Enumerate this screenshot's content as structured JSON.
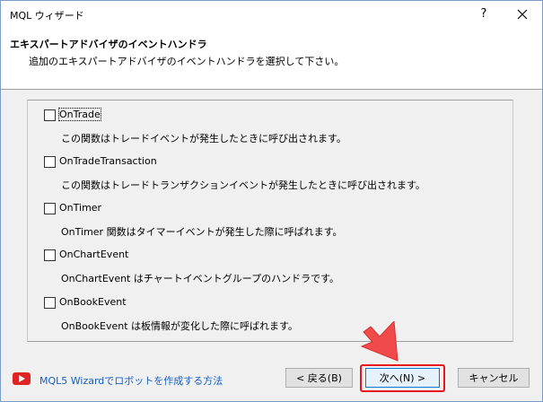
{
  "window": {
    "title": "MQL ウィザード",
    "help": "?"
  },
  "header": {
    "title": "エキスパートアドバイザのイベントハンドラ",
    "subtitle": "追加のエキスパートアドバイザのイベントハンドラを選択して下さい。"
  },
  "options": [
    {
      "label": "OnTrade",
      "description": "この関数はトレードイベントが発生したときに呼び出されます。",
      "checked": false
    },
    {
      "label": "OnTradeTransaction",
      "description": "この関数はトレードトランザクションイベントが発生したときに呼び出されます。",
      "checked": false
    },
    {
      "label": "OnTimer",
      "description": "OnTimer 関数はタイマーイベントが発生した際に呼ばれます。",
      "checked": false
    },
    {
      "label": "OnChartEvent",
      "description": "OnChartEvent はチャートイベントグループのハンドラです。",
      "checked": false
    },
    {
      "label": "OnBookEvent",
      "description": "OnBookEvent は板情報が変化した際に呼ばれます。",
      "checked": false
    }
  ],
  "footer": {
    "link": "MQL5 Wizardでロボットを作成する方法",
    "back": "< 戻る(B)",
    "next": "次へ(N) >",
    "cancel": "キャンセル"
  },
  "colors": {
    "link": "#1560c8",
    "highlight": "#e8141e",
    "youtube": "#e02424",
    "arrow": "#f04a4a"
  }
}
